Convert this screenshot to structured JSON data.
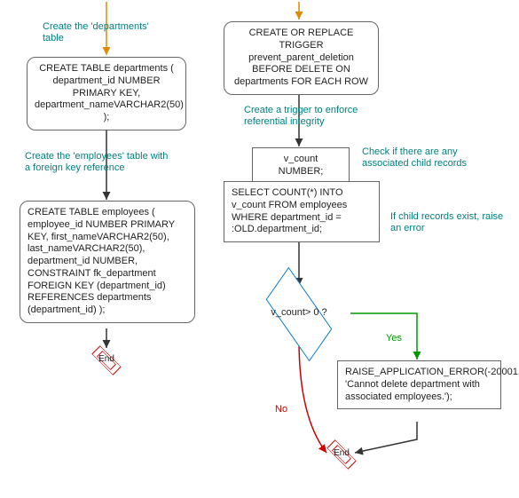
{
  "left": {
    "ann_create_dept": "Create the 'departments' table",
    "create_dept": "CREATE TABLE departments ( department_id NUMBER PRIMARY KEY, department_nameVARCHAR2(50) );",
    "ann_create_emp": "Create the 'employees' table with a foreign key reference",
    "create_emp": "CREATE TABLE employees ( employee_id NUMBER PRIMARY KEY, first_nameVARCHAR2(50), last_nameVARCHAR2(50), department_id NUMBER, CONSTRAINT fk_department FOREIGN KEY (department_id) REFERENCES departments (department_id) );",
    "end": "End"
  },
  "right": {
    "trigger_header": "CREATE OR REPLACE TRIGGER prevent_parent_deletion BEFORE DELETE ON departments FOR EACH ROW",
    "ann_trigger": "Create a trigger to enforce referential integrity",
    "vcount_decl": "v_count NUMBER;",
    "ann_check_child": "Check if there are any associated child records",
    "select_count": "SELECT COUNT(*) INTO v_count FROM employees WHERE department_id = :OLD.department_id;",
    "ann_raise": "If child records exist, raise an error",
    "decision": "v_count> 0 ?",
    "yes": "Yes",
    "no": "No",
    "raise_err": "RAISE_APPLICATION_ERROR(-20001, 'Cannot delete department with associated employees.');",
    "end": "End"
  },
  "chart_data": {
    "type": "flowchart",
    "flows": [
      {
        "name": "left-flow",
        "start": "left-start",
        "nodes": [
          {
            "id": "l-ann1",
            "type": "annotation",
            "text": "Create the 'departments' table"
          },
          {
            "id": "l-box1",
            "type": "process-round",
            "text": "CREATE TABLE departments ( department_id NUMBER PRIMARY KEY, department_nameVARCHAR2(50) );"
          },
          {
            "id": "l-ann2",
            "type": "annotation",
            "text": "Create the 'employees' table with a foreign key reference"
          },
          {
            "id": "l-box2",
            "type": "process-round",
            "text": "CREATE TABLE employees ( employee_id NUMBER PRIMARY KEY, first_nameVARCHAR2(50), last_nameVARCHAR2(50), department_id NUMBER, CONSTRAINT fk_department FOREIGN KEY (department_id) REFERENCES departments (department_id) );"
          },
          {
            "id": "l-end",
            "type": "terminator",
            "text": "End"
          }
        ],
        "edges": [
          {
            "from": "left-start",
            "to": "l-box1"
          },
          {
            "from": "l-box1",
            "to": "l-box2"
          },
          {
            "from": "l-box2",
            "to": "l-end"
          }
        ]
      },
      {
        "name": "right-flow",
        "start": "right-start",
        "nodes": [
          {
            "id": "r-box1",
            "type": "process-round",
            "text": "CREATE OR REPLACE TRIGGER prevent_parent_deletion BEFORE DELETE ON departments FOR EACH ROW"
          },
          {
            "id": "r-ann1",
            "type": "annotation",
            "text": "Create a trigger to enforce referential integrity"
          },
          {
            "id": "r-box2",
            "type": "process-rect",
            "text": "v_count NUMBER;"
          },
          {
            "id": "r-ann2",
            "type": "annotation",
            "text": "Check if there are any associated child records"
          },
          {
            "id": "r-box3",
            "type": "process-rect",
            "text": "SELECT COUNT(*) INTO v_count FROM employees WHERE department_id = :OLD.department_id;"
          },
          {
            "id": "r-ann3",
            "type": "annotation",
            "text": "If child records exist, raise an error"
          },
          {
            "id": "r-dec",
            "type": "decision",
            "text": "v_count> 0 ?"
          },
          {
            "id": "r-box4",
            "type": "process-rect",
            "text": "RAISE_APPLICATION_ERROR(-20001, 'Cannot delete department with associated employees.');"
          },
          {
            "id": "r-end",
            "type": "terminator",
            "text": "End"
          }
        ],
        "edges": [
          {
            "from": "right-start",
            "to": "r-box1"
          },
          {
            "from": "r-box1",
            "to": "r-box2"
          },
          {
            "from": "r-box2",
            "to": "r-box3"
          },
          {
            "from": "r-box3",
            "to": "r-dec"
          },
          {
            "from": "r-dec",
            "to": "r-box4",
            "label": "Yes",
            "color": "#009900"
          },
          {
            "from": "r-dec",
            "to": "r-end",
            "label": "No",
            "color": "#cc0000"
          },
          {
            "from": "r-box4",
            "to": "r-end"
          }
        ]
      }
    ]
  }
}
